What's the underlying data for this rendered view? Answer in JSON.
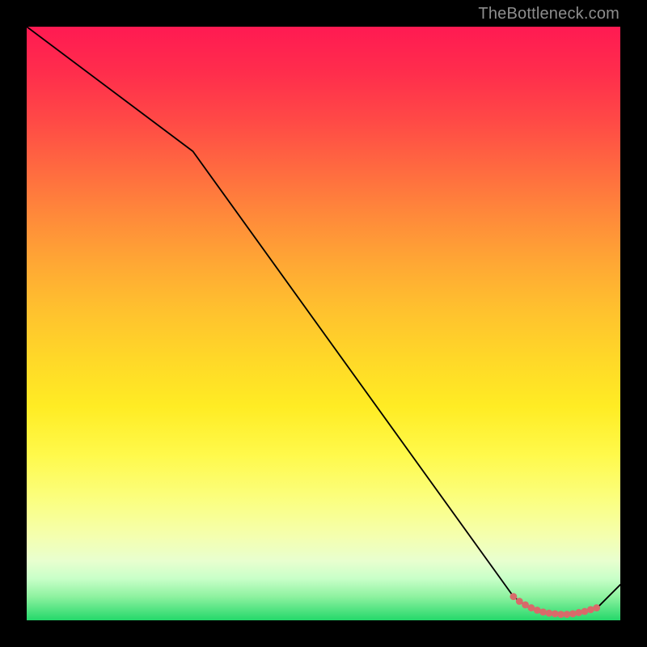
{
  "watermark": "TheBottleneck.com",
  "chart_data": {
    "type": "line",
    "title": "",
    "xlabel": "",
    "ylabel": "",
    "xlim": [
      0,
      100
    ],
    "ylim": [
      0,
      100
    ],
    "grid": false,
    "series": [
      {
        "name": "curve",
        "color": "#000000",
        "x": [
          0,
          28,
          82,
          84,
          86,
          88,
          90,
          92,
          94,
          96,
          100
        ],
        "y": [
          100,
          79,
          4,
          2.5,
          1.5,
          1,
          1,
          1,
          1.5,
          2,
          6
        ]
      }
    ],
    "markers": {
      "name": "highlight-points",
      "color": "#d86a6a",
      "radius_pct": 0.6,
      "x": [
        82,
        83,
        84,
        85,
        86,
        87,
        88,
        89,
        90,
        91,
        92,
        93,
        94,
        95,
        96
      ],
      "y": [
        4,
        3.2,
        2.6,
        2.1,
        1.7,
        1.4,
        1.2,
        1.1,
        1.0,
        1.0,
        1.1,
        1.3,
        1.5,
        1.8,
        2.1
      ]
    },
    "background_gradient": {
      "orientation": "vertical",
      "stops": [
        {
          "pos": 0.0,
          "color": "#ff1a52"
        },
        {
          "pos": 0.5,
          "color": "#ffd828"
        },
        {
          "pos": 0.85,
          "color": "#f4ffb0"
        },
        {
          "pos": 1.0,
          "color": "#24d86a"
        }
      ]
    }
  }
}
